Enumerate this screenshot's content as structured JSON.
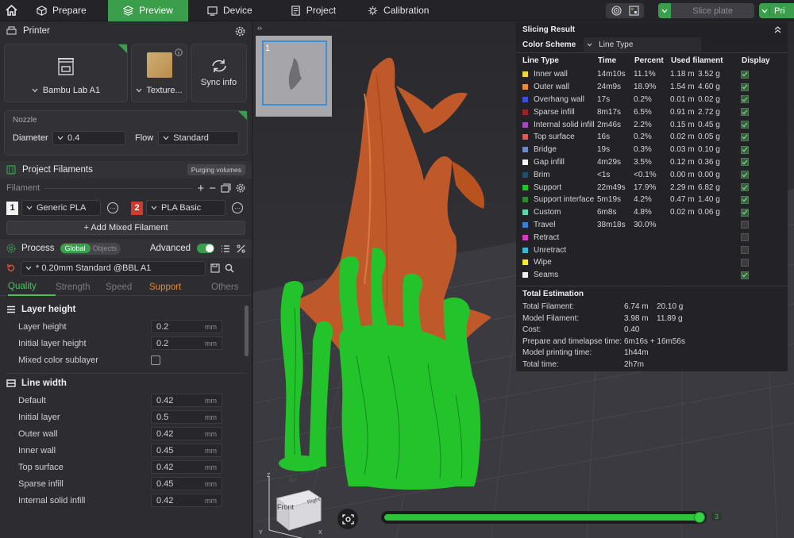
{
  "topbar": {
    "tabs": [
      {
        "label": "Prepare",
        "icon": "cube-icon"
      },
      {
        "label": "Preview",
        "icon": "layers-icon",
        "active": true
      },
      {
        "label": "Device",
        "icon": "device-icon"
      },
      {
        "label": "Project",
        "icon": "project-icon"
      },
      {
        "label": "Calibration",
        "icon": "calibration-icon"
      }
    ],
    "slice_label": "Slice plate",
    "print_label": "Pri"
  },
  "printer": {
    "title": "Printer",
    "printer_name": "Bambu Lab A1",
    "plate_name": "Texture...",
    "sync_label": "Sync info"
  },
  "nozzle": {
    "title": "Nozzle",
    "diameter_label": "Diameter",
    "diameter_value": "0.4",
    "flow_label": "Flow",
    "flow_value": "Standard"
  },
  "filaments": {
    "title": "Project Filaments",
    "purging_label": "Purging volumes",
    "filament_label": "Filament",
    "items": [
      {
        "index": "1",
        "name": "Generic PLA",
        "color": "#f4f4f4"
      },
      {
        "index": "2",
        "name": "PLA Basic",
        "color": "#d23b2b"
      }
    ],
    "add_mixed_label": "+ Add Mixed Filament"
  },
  "process": {
    "title": "Process",
    "global_label": "Global",
    "objects_label": "Objects",
    "advanced_label": "Advanced",
    "preset": "* 0.20mm Standard @BBL A1",
    "tabs": [
      "Quality",
      "Strength",
      "Speed",
      "Support",
      "Others"
    ],
    "layer_height_group": {
      "title": "Layer height",
      "rows": [
        {
          "label": "Layer height",
          "value": "0.2",
          "unit": "mm"
        },
        {
          "label": "Initial layer height",
          "value": "0.2",
          "unit": "mm"
        }
      ],
      "mixed_label": "Mixed color sublayer"
    },
    "line_width_group": {
      "title": "Line width",
      "rows": [
        {
          "label": "Default",
          "value": "0.42",
          "unit": "mm"
        },
        {
          "label": "Initial layer",
          "value": "0.5",
          "unit": "mm"
        },
        {
          "label": "Outer wall",
          "value": "0.42",
          "unit": "mm"
        },
        {
          "label": "Inner wall",
          "value": "0.45",
          "unit": "mm"
        },
        {
          "label": "Top surface",
          "value": "0.42",
          "unit": "mm"
        },
        {
          "label": "Sparse infill",
          "value": "0.45",
          "unit": "mm"
        },
        {
          "label": "Internal solid infill",
          "value": "0.42",
          "unit": "mm"
        }
      ]
    }
  },
  "viewport": {
    "plate_number": "1",
    "cube_labels": {
      "top": "Top",
      "front": "Front",
      "right": "Right",
      "z": "Z",
      "x": "X",
      "y": "Y"
    },
    "layer_value": "3",
    "layer_progress": 0.99
  },
  "result": {
    "title": "Slicing Result",
    "scheme_label": "Color Scheme",
    "scheme_value": "Line Type",
    "headers": [
      "Line Type",
      "Time",
      "Percent",
      "Used filament",
      "Display"
    ],
    "rows": [
      {
        "name": "Inner wall",
        "color": "#f2d43d",
        "time": "14m10s",
        "percent": "11.1%",
        "len": "1.18 m",
        "weight": "3.52 g",
        "display": true
      },
      {
        "name": "Outer wall",
        "color": "#f08a3a",
        "time": "24m9s",
        "percent": "18.9%",
        "len": "1.54 m",
        "weight": "4.60 g",
        "display": true
      },
      {
        "name": "Overhang wall",
        "color": "#3a4fe0",
        "time": "17s",
        "percent": "0.2%",
        "len": "0.01 m",
        "weight": "0.02 g",
        "display": true
      },
      {
        "name": "Sparse infill",
        "color": "#a3222a",
        "time": "8m17s",
        "percent": "6.5%",
        "len": "0.91 m",
        "weight": "2.72 g",
        "display": true
      },
      {
        "name": "Internal solid infill",
        "color": "#a248c4",
        "time": "2m46s",
        "percent": "2.2%",
        "len": "0.15 m",
        "weight": "0.45 g",
        "display": true
      },
      {
        "name": "Top surface",
        "color": "#e05a5a",
        "time": "16s",
        "percent": "0.2%",
        "len": "0.02 m",
        "weight": "0.05 g",
        "display": true
      },
      {
        "name": "Bridge",
        "color": "#6f8bc7",
        "time": "19s",
        "percent": "0.3%",
        "len": "0.03 m",
        "weight": "0.10 g",
        "display": true
      },
      {
        "name": "Gap infill",
        "color": "#f4f4f4",
        "time": "4m29s",
        "percent": "3.5%",
        "len": "0.12 m",
        "weight": "0.36 g",
        "display": true
      },
      {
        "name": "Brim",
        "color": "#1f4f6e",
        "time": "<1s",
        "percent": "<0.1%",
        "len": "0.00 m",
        "weight": "0.00 g",
        "display": true
      },
      {
        "name": "Support",
        "color": "#1ec628",
        "time": "22m49s",
        "percent": "17.9%",
        "len": "2.29 m",
        "weight": "6.82 g",
        "display": true
      },
      {
        "name": "Support interface",
        "color": "#2f8a2f",
        "time": "5m19s",
        "percent": "4.2%",
        "len": "0.47 m",
        "weight": "1.40 g",
        "display": true
      },
      {
        "name": "Custom",
        "color": "#5ed6a8",
        "time": "6m8s",
        "percent": "4.8%",
        "len": "0.02 m",
        "weight": "0.06 g",
        "display": true
      },
      {
        "name": "Travel",
        "color": "#3a7fd6",
        "time": "38m18s",
        "percent": "30.0%",
        "len": "",
        "weight": "",
        "display": false
      },
      {
        "name": "Retract",
        "color": "#d63ac0",
        "time": "",
        "percent": "",
        "len": "",
        "weight": "",
        "display": false
      },
      {
        "name": "Unretract",
        "color": "#3ab8d6",
        "time": "",
        "percent": "",
        "len": "",
        "weight": "",
        "display": false
      },
      {
        "name": "Wipe",
        "color": "#f4ee2a",
        "time": "",
        "percent": "",
        "len": "",
        "weight": "",
        "display": false
      },
      {
        "name": "Seams",
        "color": "#efefef",
        "time": "",
        "percent": "",
        "len": "",
        "weight": "",
        "display": true
      }
    ],
    "estimation_title": "Total Estimation",
    "estimation": [
      {
        "label": "Total Filament:",
        "a": "6.74 m",
        "b": "20.10 g"
      },
      {
        "label": "Model Filament:",
        "a": "3.98 m",
        "b": "11.89 g"
      },
      {
        "label": "Cost:",
        "a": "0.40",
        "b": ""
      },
      {
        "label": "Prepare and timelapse time:",
        "a": "6m16s + 16m56s",
        "b": ""
      },
      {
        "label": "Model printing time:",
        "a": "1h44m",
        "b": ""
      },
      {
        "label": "Total time:",
        "a": "2h7m",
        "b": ""
      }
    ]
  }
}
